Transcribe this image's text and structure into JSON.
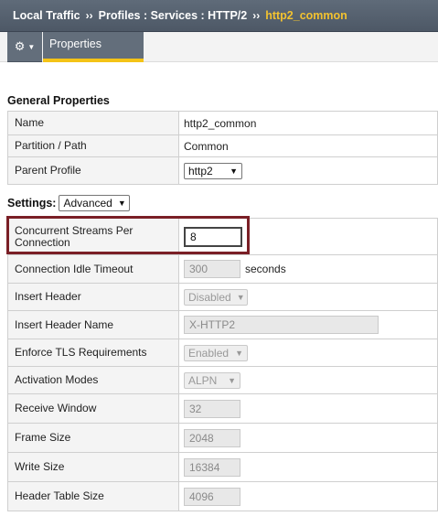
{
  "breadcrumb": {
    "items": [
      "Local Traffic",
      "Profiles : Services : HTTP/2"
    ],
    "separator": "››",
    "current": "http2_common"
  },
  "tabs": {
    "menu_icon": "gear-icon",
    "properties_label": "Properties"
  },
  "general": {
    "title": "General Properties",
    "name_label": "Name",
    "name_value": "http2_common",
    "partition_label": "Partition / Path",
    "partition_value": "Common",
    "parent_label": "Parent Profile",
    "parent_value": "http2"
  },
  "settings": {
    "label": "Settings:",
    "mode": "Advanced",
    "rows": {
      "concurrent_streams_label": "Concurrent Streams Per Connection",
      "concurrent_streams_value": "8",
      "idle_timeout_label": "Connection Idle Timeout",
      "idle_timeout_value": "300",
      "idle_timeout_unit": "seconds",
      "insert_header_label": "Insert Header",
      "insert_header_value": "Disabled",
      "insert_header_name_label": "Insert Header Name",
      "insert_header_name_value": "X-HTTP2",
      "enforce_tls_label": "Enforce TLS Requirements",
      "enforce_tls_value": "Enabled",
      "activation_modes_label": "Activation Modes",
      "activation_modes_value": "ALPN",
      "receive_window_label": "Receive Window",
      "receive_window_value": "32",
      "frame_size_label": "Frame Size",
      "frame_size_value": "2048",
      "write_size_label": "Write Size",
      "write_size_value": "16384",
      "header_table_size_label": "Header Table Size",
      "header_table_size_value": "4096"
    }
  },
  "colors": {
    "breadcrumb_current": "#f2c230",
    "tab_accent": "#f4c316",
    "highlight_border": "#7a1f26"
  }
}
